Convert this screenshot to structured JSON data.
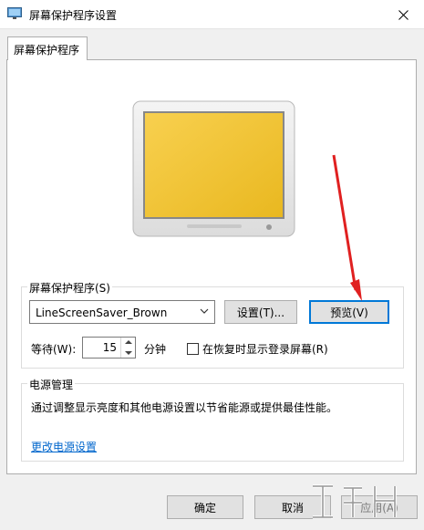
{
  "window": {
    "title": "屏幕保护程序设置"
  },
  "tab": {
    "label": "屏幕保护程序"
  },
  "screensaver_group": {
    "title": "屏幕保护程序(S)",
    "selected": "LineScreenSaver_Brown",
    "settings_label": "设置(T)...",
    "preview_label": "预览(V)",
    "wait_label": "等待(W):",
    "wait_value": "15",
    "wait_unit": "分钟",
    "logon_label": "在恢复时显示登录屏幕(R)"
  },
  "power_group": {
    "title": "电源管理",
    "description": "通过调整显示亮度和其他电源设置以节省能源或提供最佳性能。",
    "link": "更改电源设置"
  },
  "footer": {
    "ok_label": "确定",
    "cancel_label": "取消",
    "apply_label": "应用(A)"
  },
  "colors": {
    "screen": "#f5c842",
    "focus": "#0078d7",
    "annotation_arrow": "#e02020"
  },
  "icons": {
    "title": "display-settings-icon",
    "close": "close-icon",
    "combo_arrow": "chevron-down-icon"
  }
}
